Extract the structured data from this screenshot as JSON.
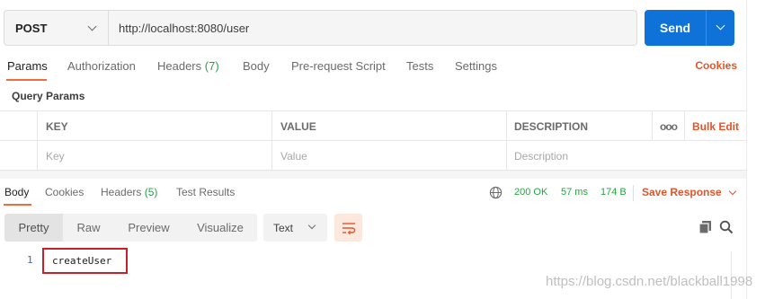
{
  "request": {
    "method": "POST",
    "url": "http://localhost:8080/user",
    "send_label": "Send"
  },
  "request_tabs": [
    {
      "label": "Params"
    },
    {
      "label": "Authorization"
    },
    {
      "label": "Headers",
      "count": "(7)"
    },
    {
      "label": "Body"
    },
    {
      "label": "Pre-request Script"
    },
    {
      "label": "Tests"
    },
    {
      "label": "Settings"
    }
  ],
  "cookies_label": "Cookies",
  "query_params": {
    "title": "Query Params",
    "headers": {
      "key": "KEY",
      "value": "VALUE",
      "description": "DESCRIPTION",
      "more": "ooo",
      "bulk_edit": "Bulk Edit"
    },
    "placeholders": {
      "key": "Key",
      "value": "Value",
      "description": "Description"
    }
  },
  "response_tabs": [
    {
      "label": "Body"
    },
    {
      "label": "Cookies"
    },
    {
      "label": "Headers",
      "count": "(5)"
    },
    {
      "label": "Test Results"
    }
  ],
  "response_meta": {
    "status": "200 OK",
    "time": "57 ms",
    "size": "174 B",
    "save_label": "Save Response"
  },
  "view_modes": [
    "Pretty",
    "Raw",
    "Preview",
    "Visualize"
  ],
  "format": "Text",
  "code": {
    "line_number": "1",
    "content": "createUser"
  },
  "watermark": "https://blog.csdn.net/blackball1998",
  "colors": {
    "accent": "#f26b3a",
    "send": "#0f72d8",
    "success": "#26a641",
    "link": "#e0562c",
    "highlight": "#c8202a"
  }
}
